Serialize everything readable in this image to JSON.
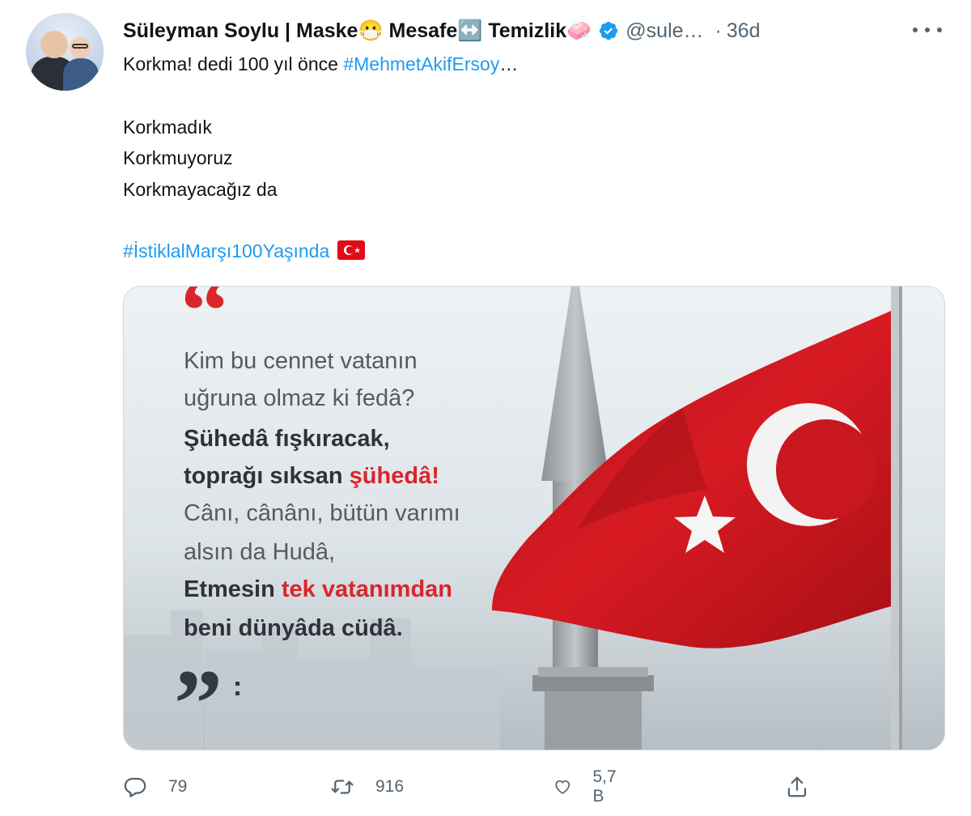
{
  "tweet": {
    "display_name": "Süleyman Soylu | Maske😷 Mesafe↔️ Temizlik🧼",
    "handle": "@sule…",
    "separator": "·",
    "time": "36d",
    "line1_text": "Korkma! dedi 100 yıl önce ",
    "line1_hashtag": "#MehmetAkifErsoy",
    "line1_ellipsis": "…",
    "body_lines": [
      "Korkmadık",
      "Korkmuyoruz",
      "Korkmayacağız da"
    ],
    "hashtag2": "#İstiklalMarşı100Yaşında",
    "flag_emoji": "turkey-flag-emoji"
  },
  "image": {
    "lines": [
      {
        "segments": [
          {
            "t": "Kim bu cennet vatanın",
            "style": "light"
          }
        ]
      },
      {
        "segments": [
          {
            "t": "uğruna olmaz ki fedâ?",
            "style": "light"
          }
        ]
      },
      {
        "segments": [
          {
            "t": "Şühedâ fışkıracak,",
            "style": "bold"
          }
        ]
      },
      {
        "segments": [
          {
            "t": "toprağı sıksan ",
            "style": "bold"
          },
          {
            "t": "şühedâ!",
            "style": "red"
          }
        ]
      },
      {
        "segments": [
          {
            "t": "Cânı, cânânı, bütün varımı",
            "style": "light"
          }
        ]
      },
      {
        "segments": [
          {
            "t": "alsın da Hudâ,",
            "style": "light"
          }
        ]
      },
      {
        "segments": [
          {
            "t": "Etmesin ",
            "style": "bold"
          },
          {
            "t": "tek vatanımdan",
            "style": "red"
          }
        ]
      },
      {
        "segments": [
          {
            "t": "beni dünyâda cüdâ.",
            "style": "bold"
          }
        ]
      }
    ],
    "open_quote": "“",
    "close_quote": "”"
  },
  "actions": {
    "reply_count": "79",
    "retweet_count": "916",
    "like_count": "5,7 B",
    "share_label": ""
  },
  "colors": {
    "link": "#1d9bf0",
    "muted": "#536471",
    "flag_red": "#e30a17",
    "verified": "#1d9bf0"
  }
}
